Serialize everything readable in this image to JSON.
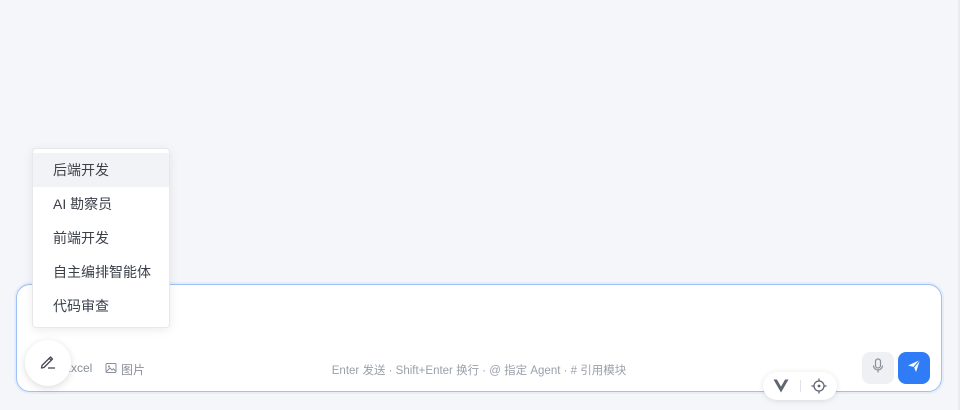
{
  "agent_menu": {
    "items": [
      {
        "label": "后端开发",
        "active": true
      },
      {
        "label": "AI 勘察员",
        "active": false
      },
      {
        "label": "前端开发",
        "active": false
      },
      {
        "label": "自主编排智能体",
        "active": false
      },
      {
        "label": "代码审查",
        "active": false
      }
    ]
  },
  "composer": {
    "input_value": "",
    "tools": {
      "excel_label": "Excel",
      "image_label": "图片"
    },
    "hint": "Enter 发送 · Shift+Enter 换行 · @ 指定 Agent · # 引用模块"
  },
  "icons": {
    "pen": "pen-icon",
    "image": "image-icon",
    "mic": "mic-icon",
    "send": "send-icon",
    "vue": "vue-logo-icon",
    "target": "crosshair-icon"
  },
  "colors": {
    "accent": "#2f7cf6",
    "composer_border": "#9ec1f7",
    "background": "#f5f6fa"
  }
}
